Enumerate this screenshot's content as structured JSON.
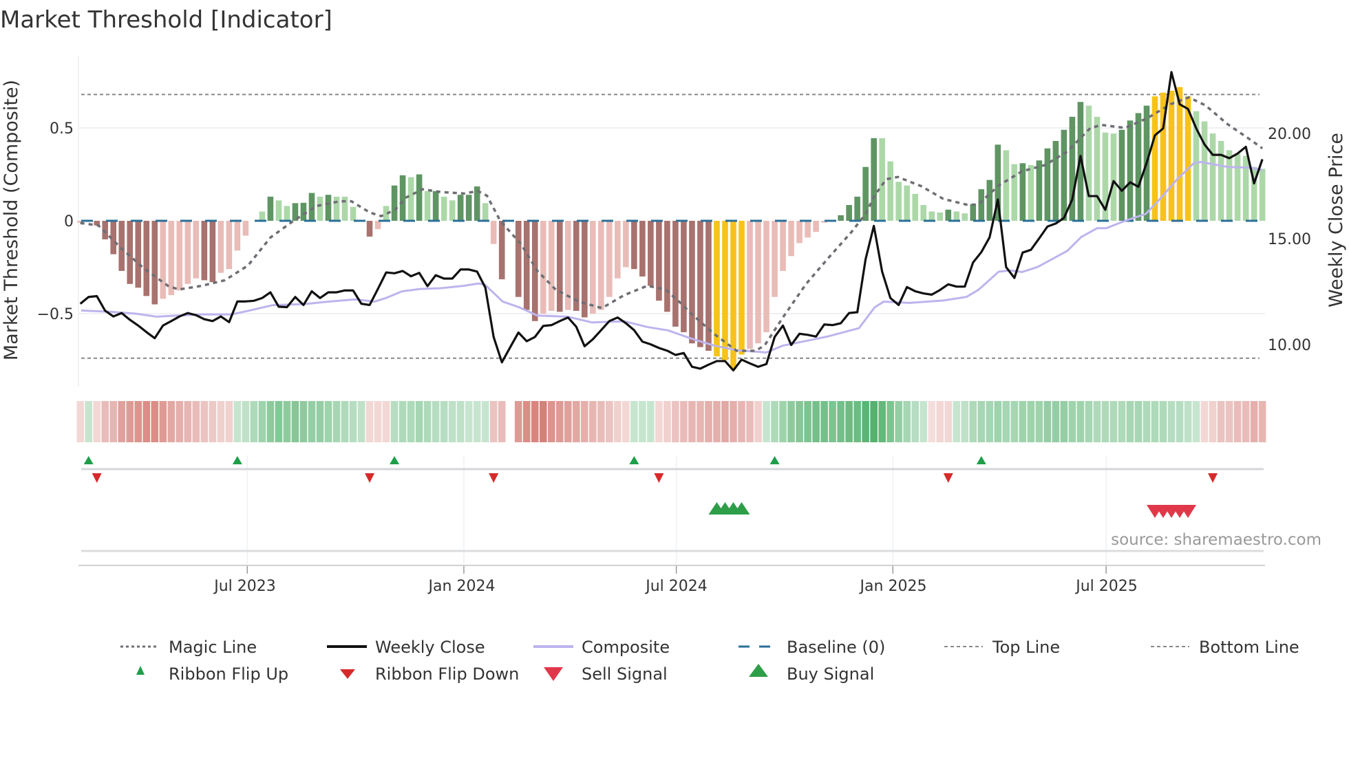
{
  "chart_data": {
    "type": "bar",
    "title": "Market Threshold [Indicator]",
    "ylabel": "Market Threshold (Composite)",
    "y2label": "Weekly Close Price",
    "source": "source: sharemaestro.com",
    "ylim": [
      -0.9,
      0.88
    ],
    "y2lim": [
      8.5,
      23.5
    ],
    "yticks": [
      {
        "v": 0.5,
        "label": "0.5"
      },
      {
        "v": 0,
        "label": "0"
      },
      {
        "v": -0.5,
        "label": "−0.5"
      }
    ],
    "y2ticks": [
      {
        "v": 20,
        "label": "20.00"
      },
      {
        "v": 15,
        "label": "15.00"
      },
      {
        "v": 10,
        "label": "10.00"
      }
    ],
    "xticks": [
      {
        "week": 20.2,
        "label": "Jul 2023"
      },
      {
        "week": 46.4,
        "label": "Jan 2024"
      },
      {
        "week": 72.1,
        "label": "Jul 2024"
      },
      {
        "week": 98.3,
        "label": "Jan 2025"
      },
      {
        "week": 124.1,
        "label": "Jul 2025"
      }
    ],
    "top_line": 0.68,
    "bottom_line": -0.74,
    "baseline": 0,
    "colors": {
      "red_dark": "#a8726e",
      "red_light": "#e9bcb8",
      "green_dark": "#5f9563",
      "green_light": "#acd8a8",
      "gold": "#f7c31a",
      "magic": "#6e6e74",
      "close": "#111111",
      "composite": "#bdb4ee",
      "baseline": "#2a6f97",
      "ribbon_red": "#c8584f",
      "ribbon_green": "#34a252",
      "flip_up": "#1f9e4a",
      "flip_down": "#d62a2a",
      "sell": "#e0384a",
      "buy": "#2e9e48"
    },
    "composite_bars": [
      -0.01,
      -0.005,
      -0.025,
      -0.1,
      -0.18,
      -0.27,
      -0.34,
      -0.36,
      -0.405,
      -0.45,
      -0.42,
      -0.4,
      -0.375,
      -0.34,
      -0.31,
      -0.32,
      -0.33,
      -0.28,
      -0.26,
      -0.16,
      -0.08,
      0,
      0.05,
      0.13,
      0.11,
      0.08,
      0.095,
      0.097,
      0.15,
      0.13,
      0.14,
      0.13,
      0.13,
      0.075,
      0,
      -0.085,
      -0.045,
      0.08,
      0.19,
      0.245,
      0.235,
      0.25,
      0.16,
      0.16,
      0.13,
      0.11,
      0.14,
      0.14,
      0.185,
      0.095,
      -0.125,
      -0.315,
      null,
      -0.41,
      -0.48,
      -0.54,
      -0.5,
      -0.485,
      -0.49,
      -0.48,
      -0.485,
      -0.52,
      -0.5,
      -0.48,
      -0.41,
      -0.31,
      -0.25,
      -0.26,
      -0.3,
      -0.35,
      -0.43,
      -0.49,
      -0.57,
      -0.6,
      -0.66,
      -0.68,
      -0.7,
      -0.73,
      -0.75,
      -0.8,
      -0.72,
      -0.69,
      -0.66,
      -0.6,
      -0.41,
      -0.27,
      -0.19,
      -0.12,
      -0.09,
      -0.06,
      -0.01,
      0,
      0.03,
      0.085,
      0.13,
      0.29,
      0.445,
      0.445,
      0.32,
      0.21,
      0.19,
      0.145,
      0.085,
      0.05,
      0.045,
      0.06,
      0.05,
      0.04,
      0.09,
      0.17,
      0.22,
      0.41,
      0.38,
      0.305,
      0.31,
      0.3,
      0.325,
      0.39,
      0.43,
      0.49,
      0.56,
      0.64,
      0.62,
      0.56,
      0.475,
      0.47,
      0.49,
      0.54,
      0.58,
      0.62,
      0.67,
      0.69,
      0.7,
      0.72,
      0.67,
      0.59,
      0.535,
      0.47,
      0.43,
      0.38,
      0.36,
      0.35,
      0.29,
      0.28
    ],
    "bar_shades": [
      "rl",
      "rl",
      "rd",
      "rd",
      "rd",
      "rd",
      "rd",
      "rd",
      "rd",
      "rd",
      "rl",
      "rl",
      "rl",
      "rl",
      "rl",
      "rd",
      "rd",
      "rl",
      "rl",
      "rl",
      "rl",
      "gl",
      "gl",
      "gd",
      "gl",
      "gl",
      "gd",
      "gd",
      "gd",
      "gl",
      "gd",
      "gl",
      "gl",
      "gl",
      "gl",
      "rd",
      "rl",
      "gl",
      "gd",
      "gd",
      "gl",
      "gd",
      "gl",
      "gd",
      "gl",
      "gl",
      "gd",
      "gd",
      "gd",
      "gl",
      "rl",
      "rd",
      "",
      "rd",
      "rd",
      "rd",
      "rl",
      "rl",
      "rd",
      "rl",
      "rd",
      "rd",
      "rl",
      "rl",
      "rl",
      "rl",
      "rl",
      "rd",
      "rd",
      "rd",
      "rd",
      "rd",
      "rd",
      "rd",
      "rd",
      "rd",
      "rd",
      "au",
      "au",
      "au",
      "au",
      "rl",
      "rl",
      "rl",
      "rl",
      "rl",
      "rl",
      "rl",
      "rl",
      "rl",
      "rl",
      "gl",
      "gd",
      "gd",
      "gd",
      "gd",
      "gd",
      "gl",
      "gl",
      "gl",
      "gl",
      "gl",
      "gl",
      "gl",
      "gl",
      "gd",
      "gl",
      "gl",
      "gd",
      "gd",
      "gd",
      "gd",
      "gl",
      "gl",
      "gd",
      "gl",
      "gd",
      "gd",
      "gd",
      "gd",
      "gd",
      "gd",
      "gl",
      "gl",
      "gl",
      "gl",
      "gd",
      "gd",
      "gd",
      "gd",
      "au",
      "au",
      "au",
      "au",
      "au",
      "gl",
      "gl",
      "gl",
      "gl",
      "gl",
      "gl",
      "gl",
      "gl",
      "gl"
    ],
    "weekly_close": [
      11.94,
      12.26,
      12.3,
      11.61,
      11.34,
      11.5,
      11.18,
      10.91,
      10.6,
      10.31,
      10.91,
      11.12,
      11.34,
      11.5,
      11.4,
      11.21,
      11.12,
      11.34,
      11.07,
      12.05,
      12.05,
      12.08,
      12.21,
      12.48,
      11.8,
      11.78,
      12.26,
      11.88,
      12.53,
      12.21,
      12.48,
      12.48,
      12.57,
      12.57,
      11.94,
      11.88,
      12.64,
      13.42,
      13.38,
      13.49,
      13.24,
      13.4,
      12.77,
      13.29,
      13.13,
      13.13,
      13.56,
      13.56,
      13.46,
      12.7,
      10.37,
      9.17,
      9.88,
      10.58,
      10.17,
      10.37,
      10.89,
      10.93,
      11.12,
      11.29,
      10.85,
      9.93,
      10.26,
      10.69,
      11.12,
      11.29,
      11.02,
      10.69,
      10.15,
      10.02,
      9.85,
      9.72,
      9.52,
      9.61,
      8.96,
      8.87,
      9.06,
      9.23,
      9.23,
      8.79,
      9.3,
      9.12,
      8.96,
      9.09,
      10.37,
      10.91,
      9.99,
      10.52,
      10.47,
      10.39,
      10.96,
      10.93,
      11.02,
      11.5,
      11.54,
      14.05,
      15.62,
      13.46,
      12.21,
      11.88,
      12.73,
      12.53,
      12.43,
      12.37,
      12.59,
      12.86,
      12.75,
      12.75,
      13.89,
      14.38,
      15.08,
      16.87,
      13.67,
      13.16,
      14.36,
      14.49,
      15.03,
      15.59,
      15.73,
      16.0,
      16.87,
      18.93,
      17.03,
      17.03,
      16.38,
      17.74,
      17.28,
      17.68,
      17.47,
      18.6,
      19.9,
      20.23,
      22.89,
      21.37,
      21.15,
      20.23,
      19.47,
      18.98,
      18.98,
      18.82,
      19.04,
      19.36,
      17.63,
      18.77
    ],
    "magic_line": [
      [
        0,
        -0.012
      ],
      [
        2.2,
        -0.025
      ],
      [
        5,
        -0.15
      ],
      [
        7.8,
        -0.26
      ],
      [
        10.6,
        -0.35
      ],
      [
        11.9,
        -0.37
      ],
      [
        14.7,
        -0.35
      ],
      [
        17.5,
        -0.32
      ],
      [
        20.3,
        -0.24
      ],
      [
        23,
        -0.09
      ],
      [
        25.8,
        0
      ],
      [
        28.6,
        0.08
      ],
      [
        31.4,
        0.105
      ],
      [
        32.8,
        0.105
      ],
      [
        35,
        0.045
      ],
      [
        36.4,
        0.025
      ],
      [
        38.1,
        0.06
      ],
      [
        39.4,
        0.125
      ],
      [
        41.4,
        0.17
      ],
      [
        43.6,
        0.155
      ],
      [
        46.4,
        0.147
      ],
      [
        48.1,
        0.16
      ],
      [
        49.2,
        0.135
      ],
      [
        50.8,
        0
      ],
      [
        53.3,
        -0.125
      ],
      [
        55.3,
        -0.27
      ],
      [
        57.5,
        -0.37
      ],
      [
        60.3,
        -0.435
      ],
      [
        63.1,
        -0.47
      ],
      [
        65.8,
        -0.4
      ],
      [
        68.6,
        -0.35
      ],
      [
        70.8,
        -0.37
      ],
      [
        72.8,
        -0.45
      ],
      [
        73.9,
        -0.5
      ],
      [
        76.7,
        -0.61
      ],
      [
        79.4,
        -0.7
      ],
      [
        81.7,
        -0.7
      ],
      [
        82.8,
        -0.67
      ],
      [
        85,
        -0.52
      ],
      [
        87.8,
        -0.34
      ],
      [
        90.5,
        -0.2
      ],
      [
        93.3,
        -0.06
      ],
      [
        95,
        0.037
      ],
      [
        96.1,
        0.137
      ],
      [
        97.5,
        0.224
      ],
      [
        98.9,
        0.236
      ],
      [
        101.7,
        0.187
      ],
      [
        104.4,
        0.118
      ],
      [
        107.2,
        0.087
      ],
      [
        108.6,
        0.087
      ],
      [
        111.1,
        0.19
      ],
      [
        113.9,
        0.266
      ],
      [
        116.7,
        0.3
      ],
      [
        119.4,
        0.373
      ],
      [
        122.2,
        0.5
      ],
      [
        123.6,
        0.516
      ],
      [
        126.4,
        0.5
      ],
      [
        129.1,
        0.553
      ],
      [
        131.9,
        0.628
      ],
      [
        134.1,
        0.665
      ],
      [
        136.1,
        0.622
      ],
      [
        138.8,
        0.52
      ],
      [
        141.6,
        0.435
      ],
      [
        143,
        0.39
      ]
    ],
    "composite_line": [
      [
        0.1,
        -0.483
      ],
      [
        3.6,
        -0.49
      ],
      [
        6.7,
        -0.5
      ],
      [
        9.2,
        -0.516
      ],
      [
        11.9,
        -0.51
      ],
      [
        14.7,
        -0.504
      ],
      [
        18.3,
        -0.504
      ],
      [
        20.3,
        -0.485
      ],
      [
        23.3,
        -0.454
      ],
      [
        27.2,
        -0.448
      ],
      [
        30,
        -0.435
      ],
      [
        33.3,
        -0.423
      ],
      [
        35.6,
        -0.435
      ],
      [
        36.9,
        -0.417
      ],
      [
        38.9,
        -0.38
      ],
      [
        41.1,
        -0.367
      ],
      [
        43.6,
        -0.363
      ],
      [
        46.4,
        -0.35
      ],
      [
        48.1,
        -0.338
      ],
      [
        48.9,
        -0.342
      ],
      [
        51.1,
        -0.435
      ],
      [
        53.1,
        -0.466
      ],
      [
        55.3,
        -0.51
      ],
      [
        58.9,
        -0.516
      ],
      [
        61.9,
        -0.547
      ],
      [
        65.8,
        -0.541
      ],
      [
        68.6,
        -0.572
      ],
      [
        71.1,
        -0.59
      ],
      [
        73.9,
        -0.634
      ],
      [
        76.7,
        -0.672
      ],
      [
        79.4,
        -0.697
      ],
      [
        83,
        -0.709
      ],
      [
        85,
        -0.672
      ],
      [
        87.8,
        -0.647
      ],
      [
        90.5,
        -0.622
      ],
      [
        94.2,
        -0.578
      ],
      [
        96.1,
        -0.466
      ],
      [
        97.2,
        -0.435
      ],
      [
        100.3,
        -0.442
      ],
      [
        104.4,
        -0.429
      ],
      [
        107.2,
        -0.41
      ],
      [
        108.6,
        -0.373
      ],
      [
        109.1,
        -0.354
      ],
      [
        111.1,
        -0.274
      ],
      [
        112.5,
        -0.267
      ],
      [
        113.9,
        -0.276
      ],
      [
        115.8,
        -0.249
      ],
      [
        119.4,
        -0.162
      ],
      [
        121.1,
        -0.087
      ],
      [
        123,
        -0.04
      ],
      [
        124.1,
        -0.04
      ],
      [
        126.4,
        0
      ],
      [
        128.9,
        0.037
      ],
      [
        130.5,
        0.112
      ],
      [
        132.7,
        0.224
      ],
      [
        134.7,
        0.31
      ],
      [
        135.5,
        0.317
      ],
      [
        138.8,
        0.29
      ],
      [
        141.6,
        0.286
      ],
      [
        143,
        0.274
      ]
    ],
    "ribbon": [
      -0.15,
      0.2,
      -0.15,
      -0.35,
      -0.4,
      -0.55,
      -0.6,
      -0.65,
      -0.7,
      -0.7,
      -0.6,
      -0.5,
      -0.45,
      -0.4,
      -0.35,
      -0.3,
      -0.25,
      -0.2,
      -0.2,
      0.2,
      0.25,
      0.35,
      0.45,
      0.55,
      0.6,
      0.55,
      0.6,
      0.55,
      0.5,
      0.5,
      0.45,
      0.4,
      0.35,
      0.3,
      0.25,
      -0.15,
      -0.15,
      -0.15,
      0.3,
      0.35,
      0.35,
      0.4,
      0.35,
      0.3,
      0.3,
      0.25,
      0.25,
      0.2,
      0.2,
      0.2,
      -0.3,
      -0.35,
      null,
      -0.6,
      -0.7,
      -0.75,
      -0.8,
      -0.65,
      -0.6,
      -0.55,
      -0.5,
      -0.45,
      -0.4,
      -0.35,
      -0.3,
      -0.2,
      -0.15,
      0.2,
      0.2,
      0.2,
      -0.15,
      -0.2,
      -0.3,
      -0.35,
      -0.4,
      -0.4,
      -0.45,
      -0.45,
      -0.5,
      -0.45,
      -0.4,
      -0.35,
      -0.2,
      0.2,
      0.35,
      0.45,
      0.55,
      0.6,
      0.65,
      0.7,
      0.7,
      0.65,
      0.7,
      0.75,
      0.75,
      0.85,
      0.9,
      0.8,
      0.65,
      0.5,
      0.4,
      0.3,
      0.2,
      -0.1,
      -0.15,
      -0.15,
      0.2,
      0.25,
      0.35,
      0.4,
      0.4,
      0.45,
      0.4,
      0.4,
      0.45,
      0.45,
      0.45,
      0.5,
      0.5,
      0.5,
      0.45,
      0.45,
      0.4,
      0.35,
      0.35,
      0.35,
      0.35,
      0.4,
      0.4,
      0.35,
      0.35,
      0.35,
      0.3,
      0.3,
      0.25,
      0.2,
      -0.15,
      -0.2,
      -0.3,
      -0.3,
      -0.35,
      -0.35,
      -0.45,
      -0.4
    ],
    "ribbon_flip_up": [
      1,
      19,
      38,
      67,
      84,
      109
    ],
    "ribbon_flip_down": [
      2,
      35,
      50,
      70,
      105,
      137
    ],
    "buy_signals": [
      77,
      78,
      79,
      80
    ],
    "sell_signals": [
      130,
      131,
      132,
      133,
      134
    ],
    "legend": {
      "placement": "bottom",
      "items": [
        {
          "key": "magic",
          "label": "Magic Line"
        },
        {
          "key": "close",
          "label": "Weekly Close"
        },
        {
          "key": "composite",
          "label": "Composite"
        },
        {
          "key": "baseline",
          "label": "Baseline (0)"
        },
        {
          "key": "top",
          "label": "Top Line"
        },
        {
          "key": "bottom",
          "label": "Bottom Line"
        },
        {
          "key": "flip_up",
          "label": "Ribbon Flip Up"
        },
        {
          "key": "flip_down",
          "label": "Ribbon Flip Down"
        },
        {
          "key": "sell",
          "label": "Sell Signal"
        },
        {
          "key": "buy",
          "label": "Buy Signal"
        }
      ]
    }
  }
}
